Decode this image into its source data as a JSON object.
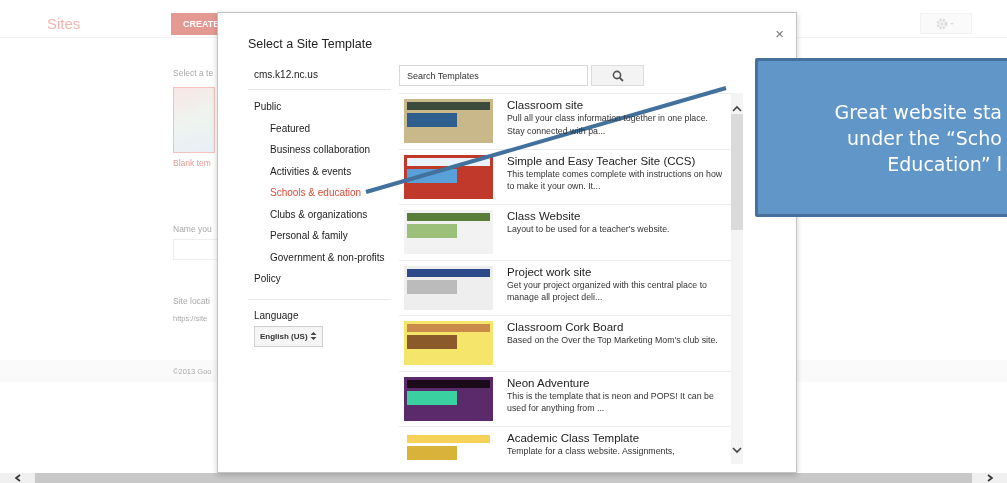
{
  "background": {
    "app_title": "Sites",
    "create_button": "CREATE",
    "section_label": "Select a te",
    "template_caption": "Blank tem",
    "name_label": "Name you",
    "location_label": "Site locati",
    "location_url": "https://site",
    "footer": "©2013 Goo"
  },
  "dialog": {
    "title": "Select a Site Template",
    "close": "×",
    "domain": "cms.k12.nc.us",
    "categories": [
      {
        "label": "Public",
        "selected": false,
        "children": [
          {
            "label": "Featured",
            "selected": false
          },
          {
            "label": "Business collaboration",
            "selected": false
          },
          {
            "label": "Activities & events",
            "selected": false
          },
          {
            "label": "Schools & education",
            "selected": true
          },
          {
            "label": "Clubs & organizations",
            "selected": false
          },
          {
            "label": "Personal & family",
            "selected": false
          },
          {
            "label": "Government & non-profits",
            "selected": false
          }
        ]
      },
      {
        "label": "Policy",
        "selected": false
      }
    ],
    "language_label": "Language",
    "language_value": "English (US)",
    "search": {
      "placeholder": "Search Templates"
    },
    "templates": [
      {
        "title": "Classroom site",
        "description": "Pull all your class information together in one place. Stay connected with pa..."
      },
      {
        "title": "Simple and Easy Teacher Site (CCS)",
        "description": "This template comes complete with instructions on how to make it your own. It..."
      },
      {
        "title": "Class Website",
        "description": "Layout to be used for a teacher's website."
      },
      {
        "title": "Project work site",
        "description": "Get your project organized with this central place to manage all project deli..."
      },
      {
        "title": "Classroom Cork Board",
        "description": "Based on the Over the Top Marketing Mom's club site."
      },
      {
        "title": "Neon Adventure",
        "description": "This is the template that is neon and POPS! It can be used for anything from ..."
      },
      {
        "title": "Academic Class Template",
        "description": "Template for a class website. Assignments,"
      }
    ]
  },
  "callout": {
    "lines": [
      "Great website sta",
      "under the “Scho",
      "Education” l"
    ]
  }
}
